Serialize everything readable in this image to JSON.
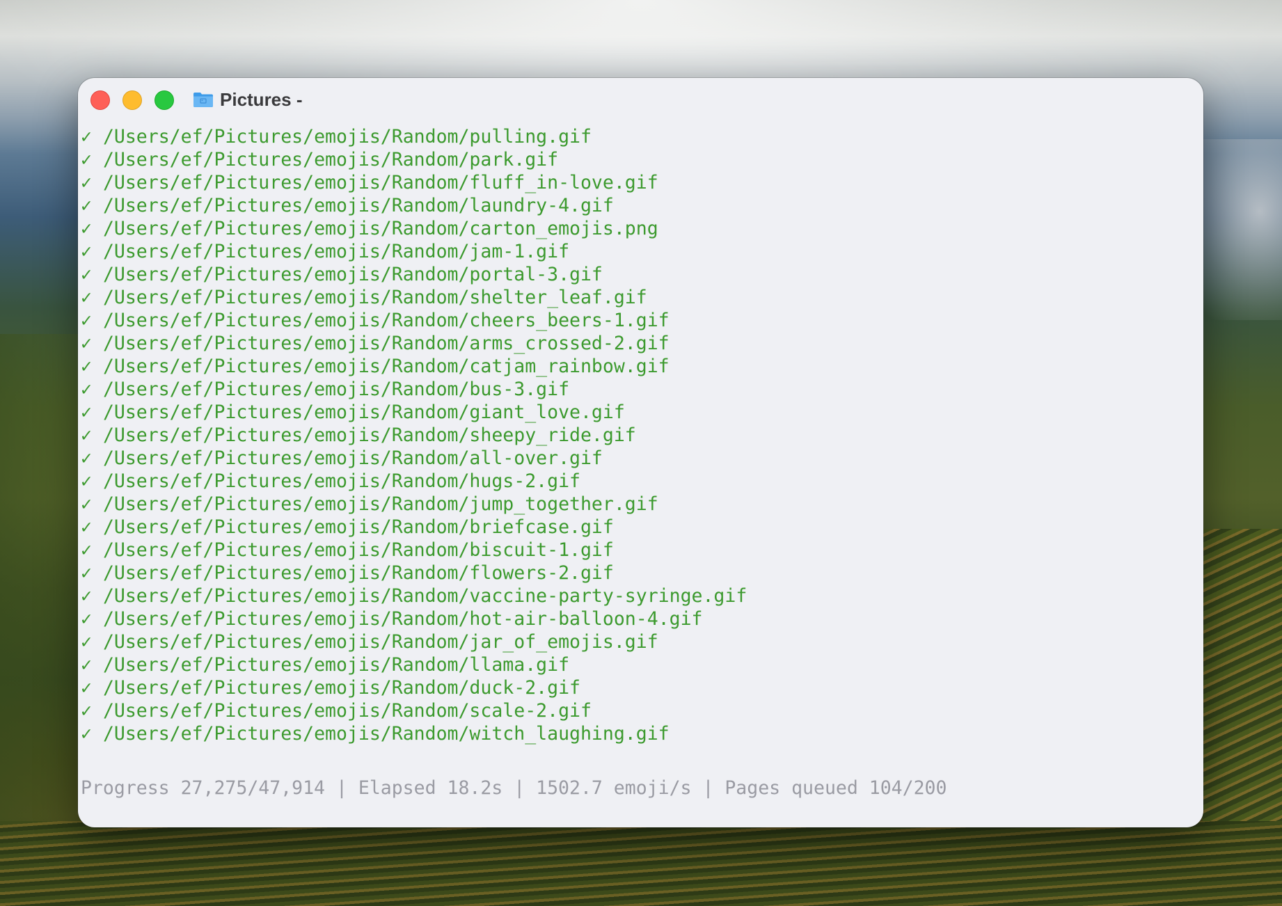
{
  "window": {
    "title": "Pictures -",
    "folder_icon": "folder-icon",
    "traffic_lights": {
      "close_color": "#fe5f57",
      "minimize_color": "#febc2e",
      "zoom_color": "#28c840"
    }
  },
  "terminal": {
    "check_glyph": "✓",
    "output_color": "#3c9a2e",
    "status_color": "#9a9ba3",
    "lines": [
      "/Users/ef/Pictures/emojis/Random/pulling.gif",
      "/Users/ef/Pictures/emojis/Random/park.gif",
      "/Users/ef/Pictures/emojis/Random/fluff_in-love.gif",
      "/Users/ef/Pictures/emojis/Random/laundry-4.gif",
      "/Users/ef/Pictures/emojis/Random/carton_emojis.png",
      "/Users/ef/Pictures/emojis/Random/jam-1.gif",
      "/Users/ef/Pictures/emojis/Random/portal-3.gif",
      "/Users/ef/Pictures/emojis/Random/shelter_leaf.gif",
      "/Users/ef/Pictures/emojis/Random/cheers_beers-1.gif",
      "/Users/ef/Pictures/emojis/Random/arms_crossed-2.gif",
      "/Users/ef/Pictures/emojis/Random/catjam_rainbow.gif",
      "/Users/ef/Pictures/emojis/Random/bus-3.gif",
      "/Users/ef/Pictures/emojis/Random/giant_love.gif",
      "/Users/ef/Pictures/emojis/Random/sheepy_ride.gif",
      "/Users/ef/Pictures/emojis/Random/all-over.gif",
      "/Users/ef/Pictures/emojis/Random/hugs-2.gif",
      "/Users/ef/Pictures/emojis/Random/jump_together.gif",
      "/Users/ef/Pictures/emojis/Random/briefcase.gif",
      "/Users/ef/Pictures/emojis/Random/biscuit-1.gif",
      "/Users/ef/Pictures/emojis/Random/flowers-2.gif",
      "/Users/ef/Pictures/emojis/Random/vaccine-party-syringe.gif",
      "/Users/ef/Pictures/emojis/Random/hot-air-balloon-4.gif",
      "/Users/ef/Pictures/emojis/Random/jar_of_emojis.gif",
      "/Users/ef/Pictures/emojis/Random/llama.gif",
      "/Users/ef/Pictures/emojis/Random/duck-2.gif",
      "/Users/ef/Pictures/emojis/Random/scale-2.gif",
      "/Users/ef/Pictures/emojis/Random/witch_laughing.gif"
    ],
    "status": "Progress 27,275/47,914 | Elapsed 18.2s | 1502.7 emoji/s | Pages queued 104/200"
  }
}
